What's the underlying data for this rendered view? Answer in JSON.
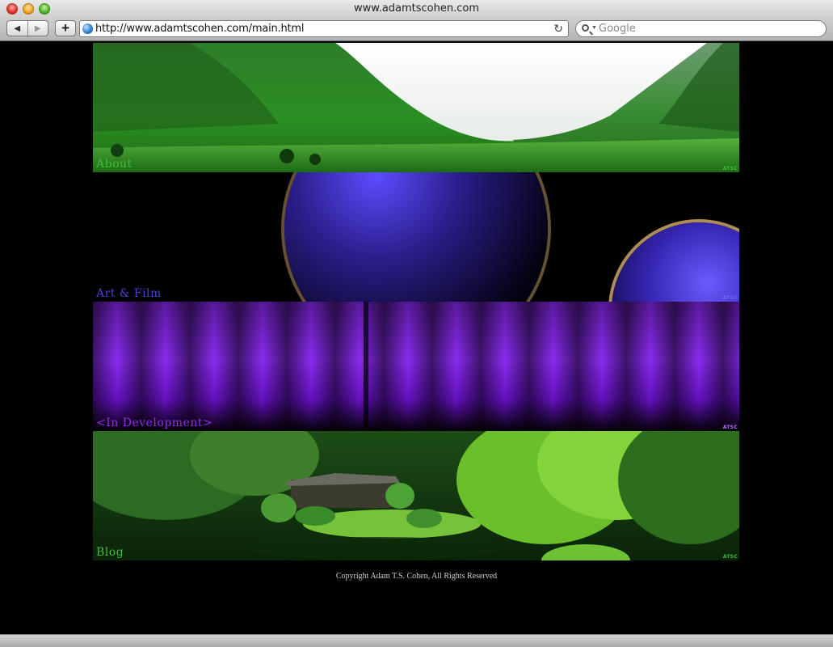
{
  "window": {
    "title": "www.adamtscohen.com"
  },
  "toolbar": {
    "back_icon": "◀",
    "forward_icon": "▶",
    "add_label": "+",
    "url": "http://www.adamtscohen.com/main.html",
    "reload_icon": "↻",
    "search_placeholder": "Google"
  },
  "page": {
    "banners": [
      {
        "label": "About",
        "signature": "ATSC",
        "label_color": "#3fbf3a",
        "signature_color": "#3fbf3a"
      },
      {
        "label": "Art & Film",
        "signature": "ATSC",
        "label_color": "#4a3fd9",
        "signature_color": "#6f68ff"
      },
      {
        "label": "<In Development>",
        "signature": "ATSC",
        "label_color": "#8e2fe6",
        "signature_color": "#b070ff"
      },
      {
        "label": "Blog",
        "signature": "ATSC",
        "label_color": "#3fbf3a",
        "signature_color": "#3fbf3a"
      }
    ],
    "copyright": "Copyright Adam T.S. Cohen, All Rights Reserved"
  }
}
